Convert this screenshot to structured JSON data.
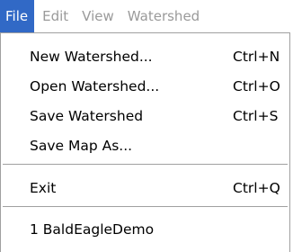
{
  "menubar": {
    "items": [
      {
        "label": "File"
      },
      {
        "label": "Edit"
      },
      {
        "label": "View"
      },
      {
        "label": "Watershed"
      }
    ]
  },
  "file_menu": {
    "items": [
      {
        "label": "New Watershed...",
        "shortcut": "Ctrl+N"
      },
      {
        "label": "Open Watershed...",
        "shortcut": "Ctrl+O"
      },
      {
        "label": "Save Watershed",
        "shortcut": "Ctrl+S"
      },
      {
        "label": "Save Map As...",
        "shortcut": ""
      },
      {
        "label": "Exit",
        "shortcut": "Ctrl+Q"
      },
      {
        "label": "1 BaldEagleDemo",
        "shortcut": ""
      }
    ]
  },
  "colors": {
    "highlight": "#3169c6",
    "disabled_text": "#9a9a9a",
    "separator": "#a0a0a0"
  }
}
